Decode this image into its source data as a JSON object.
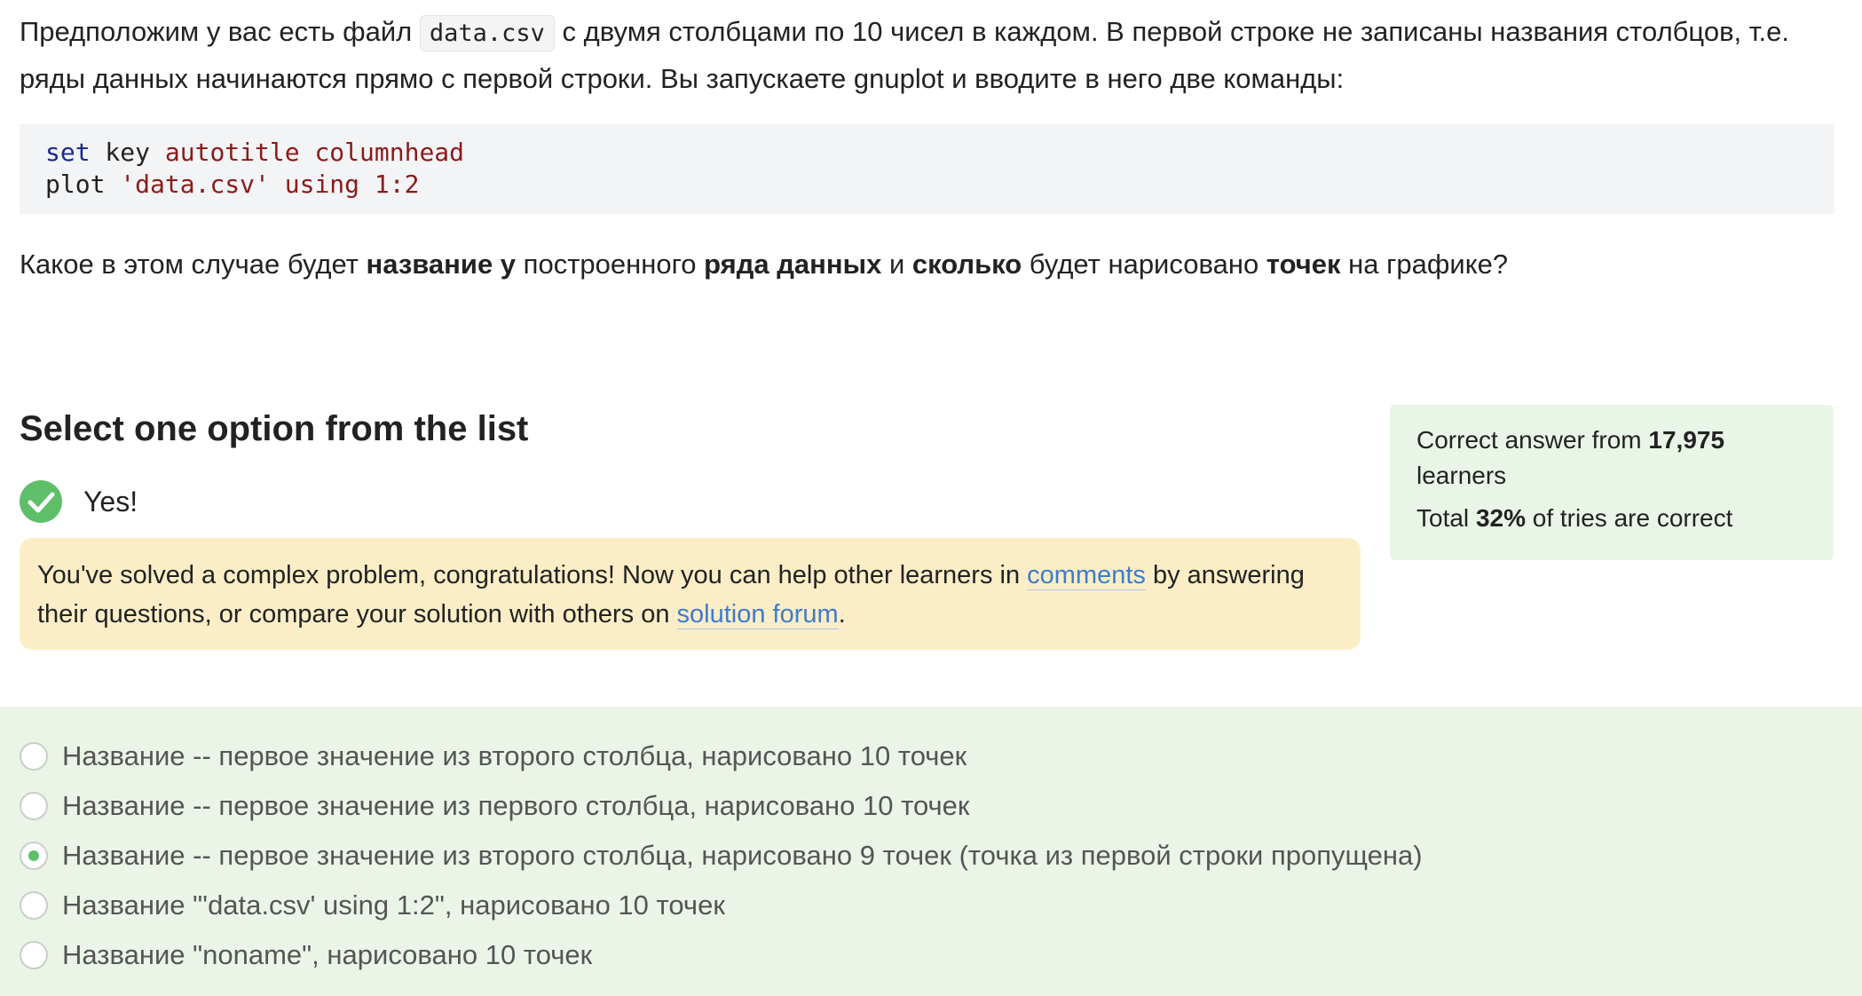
{
  "question": {
    "intro_before_code": "Предположим у вас есть файл ",
    "inline_code": "data.csv",
    "intro_after_code": " с двумя столбцами по 10 чисел в каждом. В первой строке не записаны названия столбцов, т.е. ряды данных начинаются прямо с первой строки. Вы запускаете gnuplot и вводите в него две команды:",
    "code": {
      "line1_kw": "set",
      "line1_plain": " key ",
      "line1_str": "autotitle columnhead",
      "line2_plain": "plot ",
      "line2_str": "'data.csv' using 1:2"
    },
    "q_part1": "Какое в этом случае будет ",
    "q_bold1": "название у",
    "q_part2": " построенного ",
    "q_bold2": "ряда данных",
    "q_part3": " и ",
    "q_bold3": "сколько",
    "q_part4": " будет нарисовано ",
    "q_bold4": "точек",
    "q_part5": " на графике?"
  },
  "select_title": "Select one option from the list",
  "result": {
    "icon": "check-circle-icon",
    "text": "Yes!"
  },
  "congrats": {
    "part1": "You've solved a complex problem, congratulations! Now you can help other learners in ",
    "link1": "comments",
    "part2": " by answering their questions, or compare your solution with others on ",
    "link2": "solution forum",
    "part3": "."
  },
  "stats": {
    "line1_prefix": "Correct answer from ",
    "learners_count": "17,975",
    "line1_suffix": " learners",
    "line2_prefix": "Total ",
    "percent": "32%",
    "line2_suffix": " of tries are correct"
  },
  "options": [
    {
      "label": "Название -- первое значение из второго столбца, нарисовано 10 точек",
      "selected": false
    },
    {
      "label": "Название -- первое значение из первого столбца, нарисовано 10 точек",
      "selected": false
    },
    {
      "label": "Название -- первое значение из второго столбца, нарисовано 9 точек (точка из первой строки пропущена)",
      "selected": true
    },
    {
      "label": "Название \"'data.csv' using 1:2\", нарисовано 10 точек",
      "selected": false
    },
    {
      "label": "Название \"noname\", нарисовано 10 точек",
      "selected": false
    }
  ],
  "colors": {
    "accent_green": "#5fbe6a",
    "link_blue": "#3d7ccc",
    "congrats_bg": "#fbeec7",
    "stats_bg": "#e9f6e7",
    "options_bg": "#eaf5e8"
  }
}
